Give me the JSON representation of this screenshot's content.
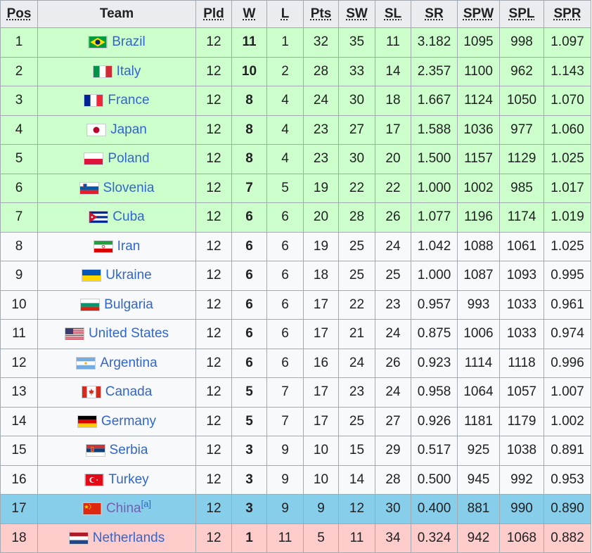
{
  "headers": {
    "pos": "Pos",
    "team": "Team",
    "pld": "Pld",
    "w": "W",
    "l": "L",
    "pts": "Pts",
    "sw": "SW",
    "sl": "SL",
    "sr": "SR",
    "spw": "SPW",
    "spl": "SPL",
    "spr": "SPR"
  },
  "row_colors": {
    "qualified": "#ccffcc",
    "host": "#87ceeb",
    "relegated": "#ffcccc",
    "normal": "#f8f9fa"
  },
  "rows": [
    {
      "pos": "1",
      "team": "Brazil",
      "flag": "brazil-flag-icon",
      "pld": "12",
      "w": "11",
      "l": "1",
      "pts": "32",
      "sw": "35",
      "sl": "11",
      "sr": "3.182",
      "spw": "1095",
      "spl": "998",
      "spr": "1.097",
      "status": "qualified"
    },
    {
      "pos": "2",
      "team": "Italy",
      "flag": "italy-flag-icon",
      "pld": "12",
      "w": "10",
      "l": "2",
      "pts": "28",
      "sw": "33",
      "sl": "14",
      "sr": "2.357",
      "spw": "1100",
      "spl": "962",
      "spr": "1.143",
      "status": "qualified"
    },
    {
      "pos": "3",
      "team": "France",
      "flag": "france-flag-icon",
      "pld": "12",
      "w": "8",
      "l": "4",
      "pts": "24",
      "sw": "30",
      "sl": "18",
      "sr": "1.667",
      "spw": "1124",
      "spl": "1050",
      "spr": "1.070",
      "status": "qualified"
    },
    {
      "pos": "4",
      "team": "Japan",
      "flag": "japan-flag-icon",
      "pld": "12",
      "w": "8",
      "l": "4",
      "pts": "23",
      "sw": "27",
      "sl": "17",
      "sr": "1.588",
      "spw": "1036",
      "spl": "977",
      "spr": "1.060",
      "status": "qualified"
    },
    {
      "pos": "5",
      "team": "Poland",
      "flag": "poland-flag-icon",
      "pld": "12",
      "w": "8",
      "l": "4",
      "pts": "23",
      "sw": "30",
      "sl": "20",
      "sr": "1.500",
      "spw": "1157",
      "spl": "1129",
      "spr": "1.025",
      "status": "qualified"
    },
    {
      "pos": "6",
      "team": "Slovenia",
      "flag": "slovenia-flag-icon",
      "pld": "12",
      "w": "7",
      "l": "5",
      "pts": "19",
      "sw": "22",
      "sl": "22",
      "sr": "1.000",
      "spw": "1002",
      "spl": "985",
      "spr": "1.017",
      "status": "qualified"
    },
    {
      "pos": "7",
      "team": "Cuba",
      "flag": "cuba-flag-icon",
      "pld": "12",
      "w": "6",
      "l": "6",
      "pts": "20",
      "sw": "28",
      "sl": "26",
      "sr": "1.077",
      "spw": "1196",
      "spl": "1174",
      "spr": "1.019",
      "status": "qualified"
    },
    {
      "pos": "8",
      "team": "Iran",
      "flag": "iran-flag-icon",
      "pld": "12",
      "w": "6",
      "l": "6",
      "pts": "19",
      "sw": "25",
      "sl": "24",
      "sr": "1.042",
      "spw": "1088",
      "spl": "1061",
      "spr": "1.025",
      "status": "normal"
    },
    {
      "pos": "9",
      "team": "Ukraine",
      "flag": "ukraine-flag-icon",
      "pld": "12",
      "w": "6",
      "l": "6",
      "pts": "18",
      "sw": "25",
      "sl": "25",
      "sr": "1.000",
      "spw": "1087",
      "spl": "1093",
      "spr": "0.995",
      "status": "normal"
    },
    {
      "pos": "10",
      "team": "Bulgaria",
      "flag": "bulgaria-flag-icon",
      "pld": "12",
      "w": "6",
      "l": "6",
      "pts": "17",
      "sw": "22",
      "sl": "23",
      "sr": "0.957",
      "spw": "993",
      "spl": "1033",
      "spr": "0.961",
      "status": "normal"
    },
    {
      "pos": "11",
      "team": "United States",
      "flag": "usa-flag-icon",
      "pld": "12",
      "w": "6",
      "l": "6",
      "pts": "17",
      "sw": "21",
      "sl": "24",
      "sr": "0.875",
      "spw": "1006",
      "spl": "1033",
      "spr": "0.974",
      "status": "normal"
    },
    {
      "pos": "12",
      "team": "Argentina",
      "flag": "argentina-flag-icon",
      "pld": "12",
      "w": "6",
      "l": "6",
      "pts": "16",
      "sw": "24",
      "sl": "26",
      "sr": "0.923",
      "spw": "1114",
      "spl": "1118",
      "spr": "0.996",
      "status": "normal"
    },
    {
      "pos": "13",
      "team": "Canada",
      "flag": "canada-flag-icon",
      "pld": "12",
      "w": "5",
      "l": "7",
      "pts": "17",
      "sw": "23",
      "sl": "24",
      "sr": "0.958",
      "spw": "1064",
      "spl": "1057",
      "spr": "1.007",
      "status": "normal"
    },
    {
      "pos": "14",
      "team": "Germany",
      "flag": "germany-flag-icon",
      "pld": "12",
      "w": "5",
      "l": "7",
      "pts": "17",
      "sw": "25",
      "sl": "27",
      "sr": "0.926",
      "spw": "1181",
      "spl": "1179",
      "spr": "1.002",
      "status": "normal"
    },
    {
      "pos": "15",
      "team": "Serbia",
      "flag": "serbia-flag-icon",
      "pld": "12",
      "w": "3",
      "l": "9",
      "pts": "10",
      "sw": "15",
      "sl": "29",
      "sr": "0.517",
      "spw": "925",
      "spl": "1038",
      "spr": "0.891",
      "status": "normal"
    },
    {
      "pos": "16",
      "team": "Turkey",
      "flag": "turkey-flag-icon",
      "pld": "12",
      "w": "3",
      "l": "9",
      "pts": "10",
      "sw": "14",
      "sl": "28",
      "sr": "0.500",
      "spw": "945",
      "spl": "992",
      "spr": "0.953",
      "status": "normal"
    },
    {
      "pos": "17",
      "team": "China",
      "note": "[a]",
      "flag": "china-flag-icon",
      "pld": "12",
      "w": "3",
      "l": "9",
      "pts": "9",
      "sw": "12",
      "sl": "30",
      "sr": "0.400",
      "spw": "881",
      "spl": "990",
      "spr": "0.890",
      "status": "host"
    },
    {
      "pos": "18",
      "team": "Netherlands",
      "flag": "netherlands-flag-icon",
      "pld": "12",
      "w": "1",
      "l": "11",
      "pts": "5",
      "sw": "11",
      "sl": "34",
      "sr": "0.324",
      "spw": "942",
      "spl": "1068",
      "spr": "0.882",
      "status": "relegated"
    }
  ]
}
